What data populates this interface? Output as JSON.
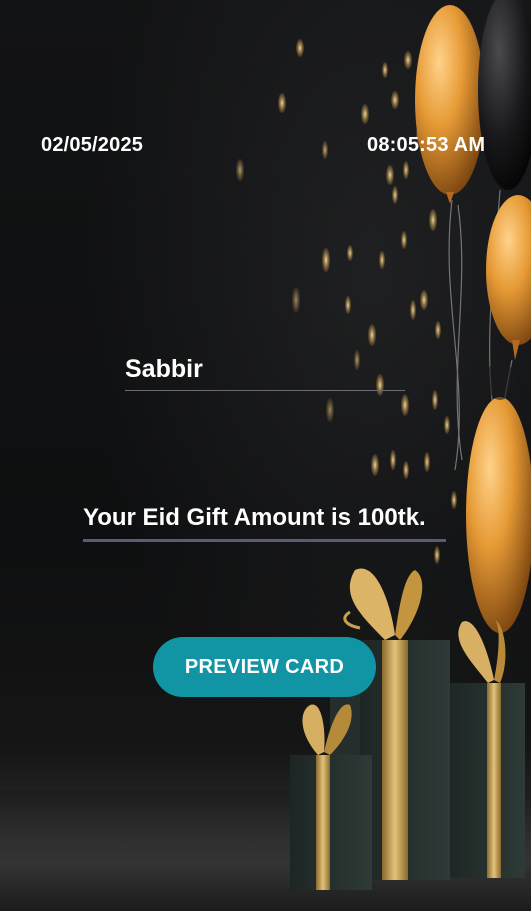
{
  "header": {
    "date": "02/05/2025",
    "time": "08:05:53 AM"
  },
  "form": {
    "name_value": "Sabbir",
    "gift_message": "Your Eid Gift Amount is 100tk."
  },
  "actions": {
    "preview_label": "PREVIEW CARD"
  },
  "colors": {
    "button": "#1195a4",
    "underline": "#5b5a78",
    "gold": "#e0a040"
  },
  "background": {
    "icons": [
      "balloons-illustration",
      "gift-boxes-illustration",
      "bokeh-lights"
    ]
  }
}
